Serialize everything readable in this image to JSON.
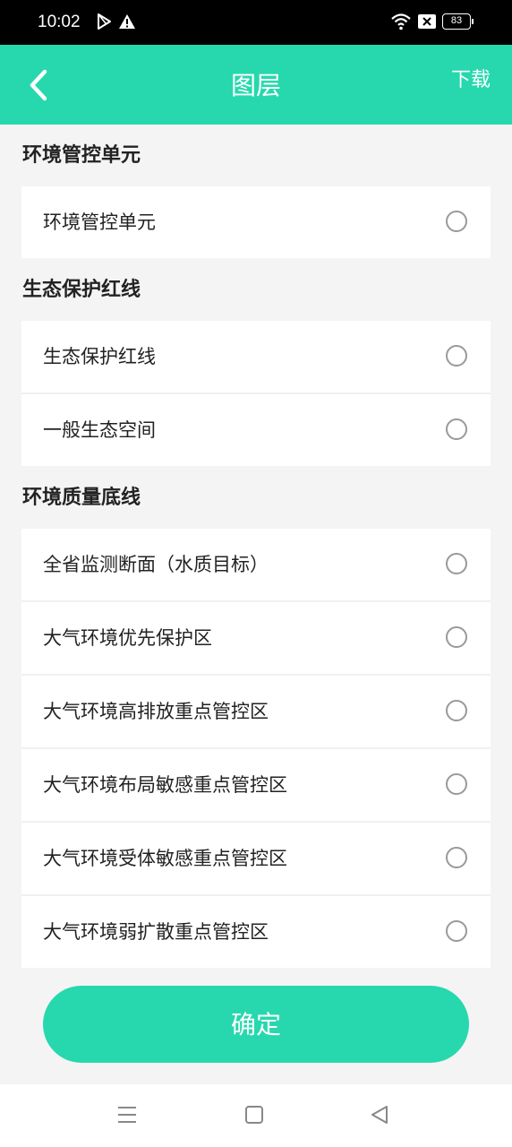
{
  "status": {
    "time": "10:02",
    "battery": "83",
    "icons": [
      "play-store-icon",
      "alert-icon",
      "wifi-icon",
      "sim-x-icon",
      "battery-icon"
    ]
  },
  "header": {
    "title": "图层",
    "download_label": "下载",
    "back_icon": "chevron-left-icon"
  },
  "sections": [
    {
      "title": "环境管控单元",
      "items": [
        {
          "label": "环境管控单元",
          "selected": false
        }
      ]
    },
    {
      "title": "生态保护红线",
      "items": [
        {
          "label": "生态保护红线",
          "selected": false
        },
        {
          "label": "一般生态空间",
          "selected": false
        }
      ]
    },
    {
      "title": "环境质量底线",
      "items": [
        {
          "label": "全省监测断面（水质目标）",
          "selected": false
        },
        {
          "label": "大气环境优先保护区",
          "selected": false
        },
        {
          "label": "大气环境高排放重点管控区",
          "selected": false
        },
        {
          "label": "大气环境布局敏感重点管控区",
          "selected": false
        },
        {
          "label": "大气环境受体敏感重点管控区",
          "selected": false
        },
        {
          "label": "大气环境弱扩散重点管控区",
          "selected": false
        }
      ]
    }
  ],
  "confirm_label": "确定",
  "nav": {
    "icons": [
      "menu-icon",
      "home-square-icon",
      "back-triangle-icon"
    ]
  },
  "colors": {
    "accent": "#27d8ae",
    "background": "#f4f4f4"
  }
}
